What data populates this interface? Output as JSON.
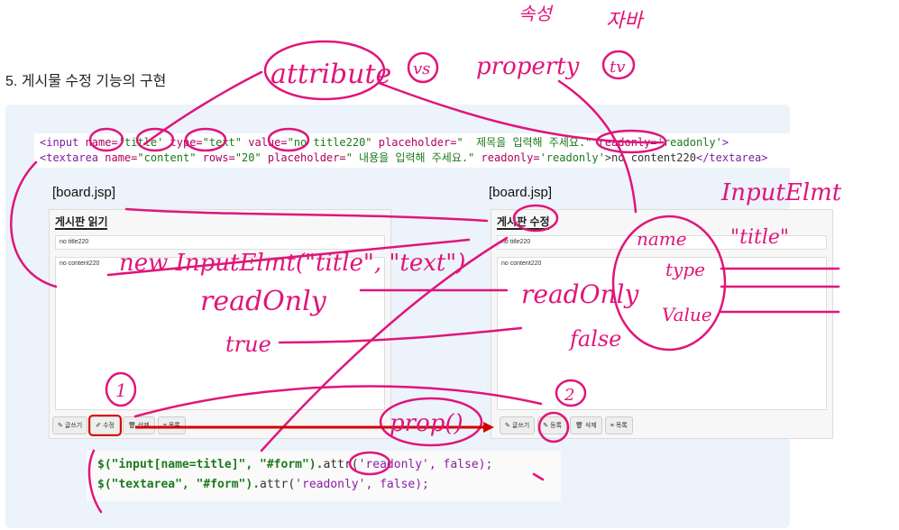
{
  "section": {
    "number": "5.",
    "title": "게시물 수정 기능의 구현"
  },
  "code": {
    "line1": {
      "open": "<input",
      "name_attr": " name=",
      "name_val": "'title'",
      "type_attr": " type=",
      "type_val": "\"text\"",
      "value_attr": " value=",
      "value_val": "\"no title220\"",
      "ph_attr": " placeholder=",
      "ph_val": "\"  제목을 입력해 주세요.\"",
      "ro_attr": " readonly=",
      "ro_val": "'readonly'",
      "close": ">"
    },
    "line2": {
      "open": "<textarea",
      "name_attr": " name=",
      "name_val": "\"content\"",
      "rows_attr": " rows=",
      "rows_val": "\"20\"",
      "ph_attr": " placeholder=",
      "ph_val": "\" 내용을 입력해 주세요.\"",
      "ro_attr": " readonly=",
      "ro_val": "'readonly'",
      "body": ">no content220",
      "close": "</textarea>"
    }
  },
  "left_board": {
    "file": "[board.jsp]",
    "title": "게시판 읽기",
    "title_value": "no title220",
    "content_value": "no content220",
    "buttons": [
      "글쓰기",
      "수정",
      "삭제",
      "목록"
    ]
  },
  "right_board": {
    "file": "[board.jsp]",
    "title": "게시판 수정",
    "title_value": "no title220",
    "content_value": "no content220",
    "buttons": [
      "글쓰기",
      "등록",
      "삭제",
      "목록"
    ]
  },
  "jquery": {
    "line1": {
      "sel": "$(\"input[name=title]\",",
      "ctx": " \"#form\").",
      "fn": "attr(",
      "arg": "'readonly',",
      "val": " false);"
    },
    "line2": {
      "sel": "$(\"textarea\",",
      "ctx": " \"#form\").",
      "fn": "attr(",
      "arg": "'readonly',",
      "val": " false);"
    }
  },
  "annotations": {
    "attribute": "attribute",
    "vs": "vs",
    "property": "property",
    "tv": "tv",
    "korean_top1": "속성",
    "korean_top2": "자바",
    "input_element": "InputElmt",
    "new_call": "new InputElmt(\"title\", \"text\")",
    "readonly_left": "readOnly",
    "true_label": "true",
    "readonly_right": "readOnly",
    "false_label": "false",
    "name": "name",
    "type": "type",
    "value": "Value",
    "title_val": "\"title\"",
    "prop": "prop()",
    "step1": "1",
    "step2": "2"
  },
  "colors": {
    "ink": "#e0157a",
    "highlight": "#d00000"
  }
}
